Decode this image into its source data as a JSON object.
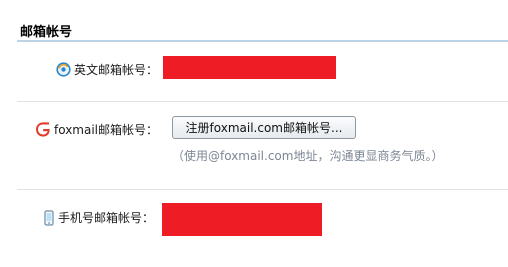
{
  "section": {
    "title": "邮箱帐号"
  },
  "rows": [
    {
      "icon": "globe-circle-icon",
      "label": "英文邮箱帐号："
    },
    {
      "icon": "foxmail-logo-icon",
      "label": "foxmail邮箱帐号：",
      "button_label": "注册foxmail.com邮箱帐号...",
      "hint": "（使用@foxmail.com地址，沟通更显商务气质。）"
    },
    {
      "icon": "mobile-phone-icon",
      "label": "手机号邮箱帐号："
    }
  ],
  "colors": {
    "redaction": "#ee1c25",
    "title_rule": "#bcd4e6",
    "hint_text": "#7d8794",
    "foxmail_brand": "#e23a2e"
  }
}
